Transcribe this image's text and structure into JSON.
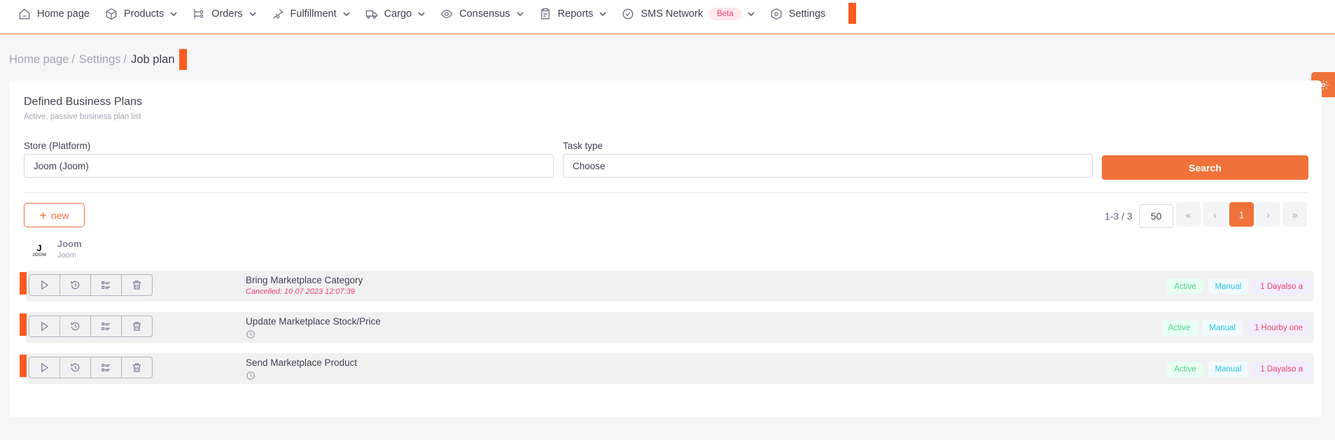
{
  "nav": {
    "items": [
      {
        "label": "Home page",
        "icon": "home-icon",
        "dropdown": false
      },
      {
        "label": "Products",
        "icon": "box-icon",
        "dropdown": true
      },
      {
        "label": "Orders",
        "icon": "orders-icon",
        "dropdown": true
      },
      {
        "label": "Fulfillment",
        "icon": "pin-icon",
        "dropdown": true
      },
      {
        "label": "Cargo",
        "icon": "truck-icon",
        "dropdown": true
      },
      {
        "label": "Consensus",
        "icon": "eye-icon",
        "dropdown": true
      },
      {
        "label": "Reports",
        "icon": "clipboard-icon",
        "dropdown": true
      },
      {
        "label": "SMS Network",
        "icon": "check-circle-icon",
        "dropdown": true,
        "badge": "Beta"
      },
      {
        "label": "Settings",
        "icon": "hexagon-gear-icon",
        "dropdown": false
      }
    ]
  },
  "breadcrumb": {
    "items": [
      "Home page",
      "Settings"
    ],
    "current": "Job plan"
  },
  "card": {
    "title": "Defined Business Plans",
    "subtitle": "Active, passive business plan list"
  },
  "filters": {
    "store_label": "Store (Platform)",
    "store_value": "Joom (Joom)",
    "task_label": "Task type",
    "task_value": "Choose",
    "search_label": "Search"
  },
  "toolbar": {
    "new_label": "new"
  },
  "pagination": {
    "count": "1-3 / 3",
    "page_size": "50",
    "first": "«",
    "prev": "‹",
    "current_page": "1",
    "next": "›",
    "last": "»"
  },
  "store": {
    "logo_letter": "J",
    "logo_text": "JOOM",
    "name": "Joom",
    "sub": "Joom"
  },
  "jobs": [
    {
      "title": "Bring Marketplace Category",
      "status_text": "Cancelled: 10 07 2023 12:07:39",
      "badges": [
        "Active",
        "Manual",
        "1 Dayalso a"
      ]
    },
    {
      "title": "Update Marketplace Stock/Price",
      "status_text": "",
      "badges": [
        "Active",
        "Manual",
        "1 Hourby one"
      ]
    },
    {
      "title": "Send Marketplace Product",
      "status_text": "",
      "badges": [
        "Active",
        "Manual",
        "1 Dayalso a"
      ]
    }
  ],
  "colors": {
    "accent": "#f0723a",
    "marker": "#ff5a1f",
    "active_badge": "#50cd89",
    "manual_badge": "#29c4e8",
    "danger": "#f1416c"
  }
}
